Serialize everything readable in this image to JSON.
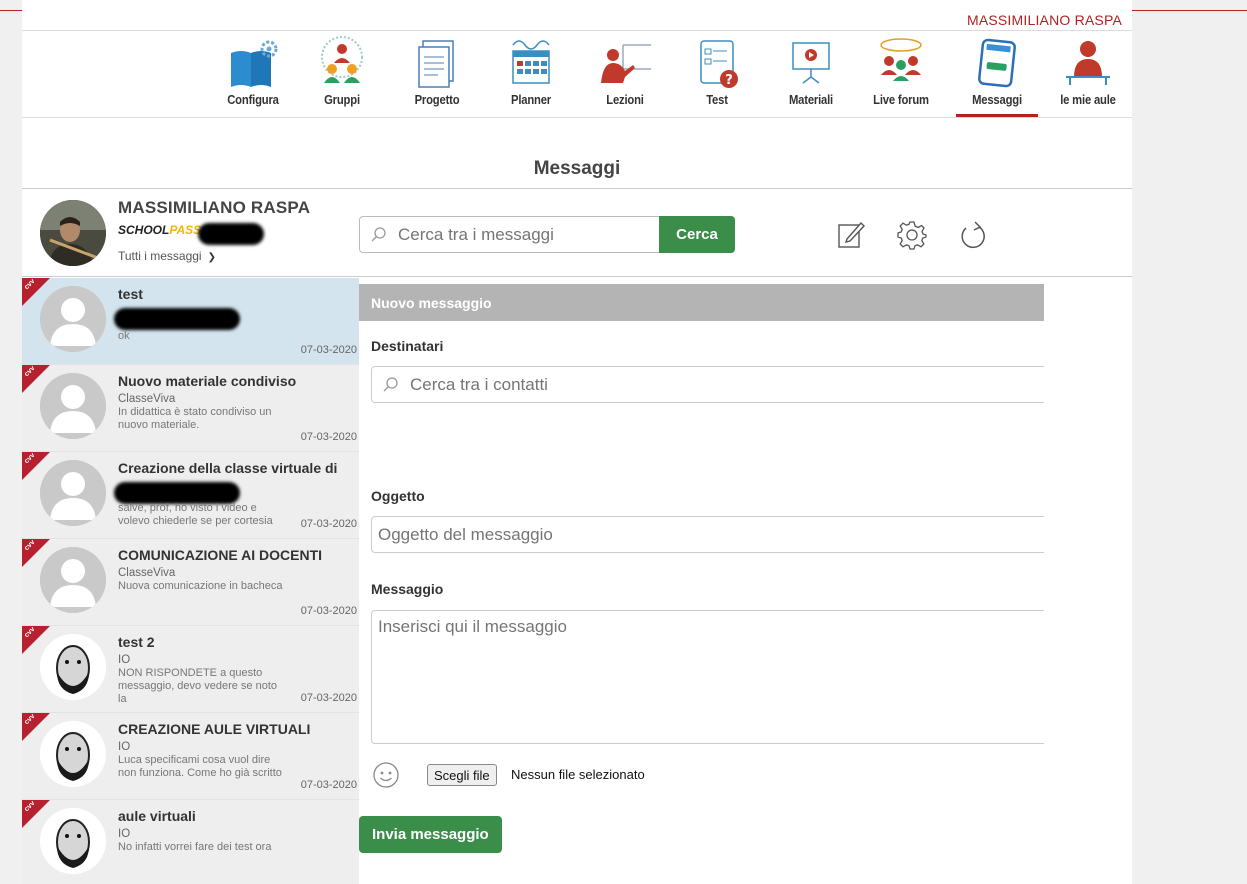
{
  "header": {
    "user_name": "MASSIMILIANO RASPA"
  },
  "nav": {
    "items": [
      {
        "label": "Configura",
        "icon": "configure-book-gear-icon"
      },
      {
        "label": "Gruppi",
        "icon": "groups-people-icon"
      },
      {
        "label": "Progetto",
        "icon": "project-document-icon"
      },
      {
        "label": "Planner",
        "icon": "planner-calendar-icon"
      },
      {
        "label": "Lezioni",
        "icon": "lessons-teacher-icon"
      },
      {
        "label": "Test",
        "icon": "test-question-icon"
      },
      {
        "label": "Materiali",
        "icon": "materials-video-board-icon"
      },
      {
        "label": "Live forum",
        "icon": "live-forum-people-icon"
      },
      {
        "label": "Messaggi",
        "icon": "messages-phone-icon"
      },
      {
        "label": "le mie aule",
        "icon": "my-classrooms-person-icon"
      }
    ],
    "active": "Messaggi"
  },
  "page": {
    "title": "Messaggi"
  },
  "profile": {
    "name": "MASSIMILIANO RASPA",
    "school_logo_prefix": "SCHOOL",
    "school_logo_suffix": "PASS",
    "filter": "Tutti i messaggi"
  },
  "search": {
    "placeholder": "Cerca tra i messaggi",
    "button": "Cerca"
  },
  "messages": [
    {
      "subject": "test",
      "from": "",
      "preview": "ok",
      "date": "07-03-2020",
      "badge": "cvv",
      "selected": true
    },
    {
      "subject": "Nuovo materiale condiviso",
      "from": "ClasseViva",
      "preview": "In didattica è stato condiviso un nuovo materiale.",
      "date": "07-03-2020",
      "badge": "cvv"
    },
    {
      "subject": "Creazione della classe virtuale di",
      "from": "",
      "preview": "salve, prof, ho visto i video e volevo chiederle se per cortesia",
      "date": "07-03-2020",
      "badge": "cvv"
    },
    {
      "subject": "COMUNICAZIONE AI DOCENTI",
      "from": "ClasseViva",
      "preview": "Nuova comunicazione in bacheca",
      "date": "07-03-2020",
      "badge": "cvv"
    },
    {
      "subject": "test 2",
      "from": "IO",
      "preview": "NON RISPONDETE a questo messaggio, devo vedere se noto la",
      "date": "07-03-2020",
      "badge": "cvv"
    },
    {
      "subject": "CREAZIONE AULE VIRTUALI",
      "from": "IO",
      "preview": "Luca specificami cosa vuol dire non funziona. Come ho già scritto",
      "date": "07-03-2020",
      "badge": "cvv"
    },
    {
      "subject": "aule virtuali",
      "from": "IO",
      "preview": "No infatti vorrei fare dei test ora",
      "date": "",
      "badge": "cvv"
    }
  ],
  "compose": {
    "header": "Nuovo messaggio",
    "recipients_label": "Destinatari",
    "recipients_placeholder": "Cerca tra i contatti",
    "subject_label": "Oggetto",
    "subject_placeholder": "Oggetto del messaggio",
    "message_label": "Messaggio",
    "message_placeholder": "Inserisci qui il messaggio",
    "file_button": "Scegli file",
    "file_status": "Nessun file selezionato",
    "send_button": "Invia messaggio"
  },
  "colors": {
    "accent_red": "#b22222",
    "action_green": "#3b8e4a",
    "selected_row": "#d3e4ee"
  }
}
